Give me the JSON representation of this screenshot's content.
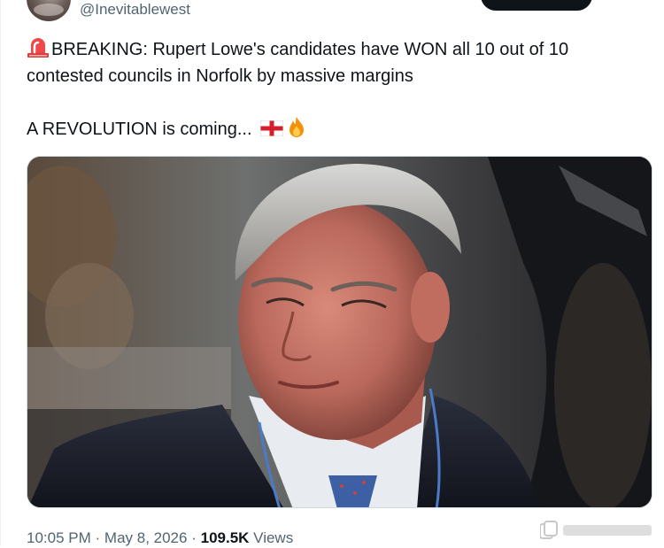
{
  "header": {
    "handle": "@Inevitablewest"
  },
  "tweet": {
    "line1": "BREAKING: Rupert Lowe's candidates have WON all 10 out of 10",
    "line2": "contested councils in Norfolk by massive margins",
    "line3": "A REVOLUTION is coming... ",
    "emojis": [
      "rotating-light-emoji",
      "england-flag-emoji",
      "fire-emoji"
    ]
  },
  "media": {
    "type": "photo",
    "icon": "photo-portrait"
  },
  "footer": {
    "time": "10:05 PM",
    "separator": "·",
    "date": "May 8, 2026",
    "views_count": "109.5K",
    "views_label": "Views"
  },
  "colors": {
    "text": "#0f1419",
    "secondary": "#536471",
    "border": "#cfd9de"
  }
}
